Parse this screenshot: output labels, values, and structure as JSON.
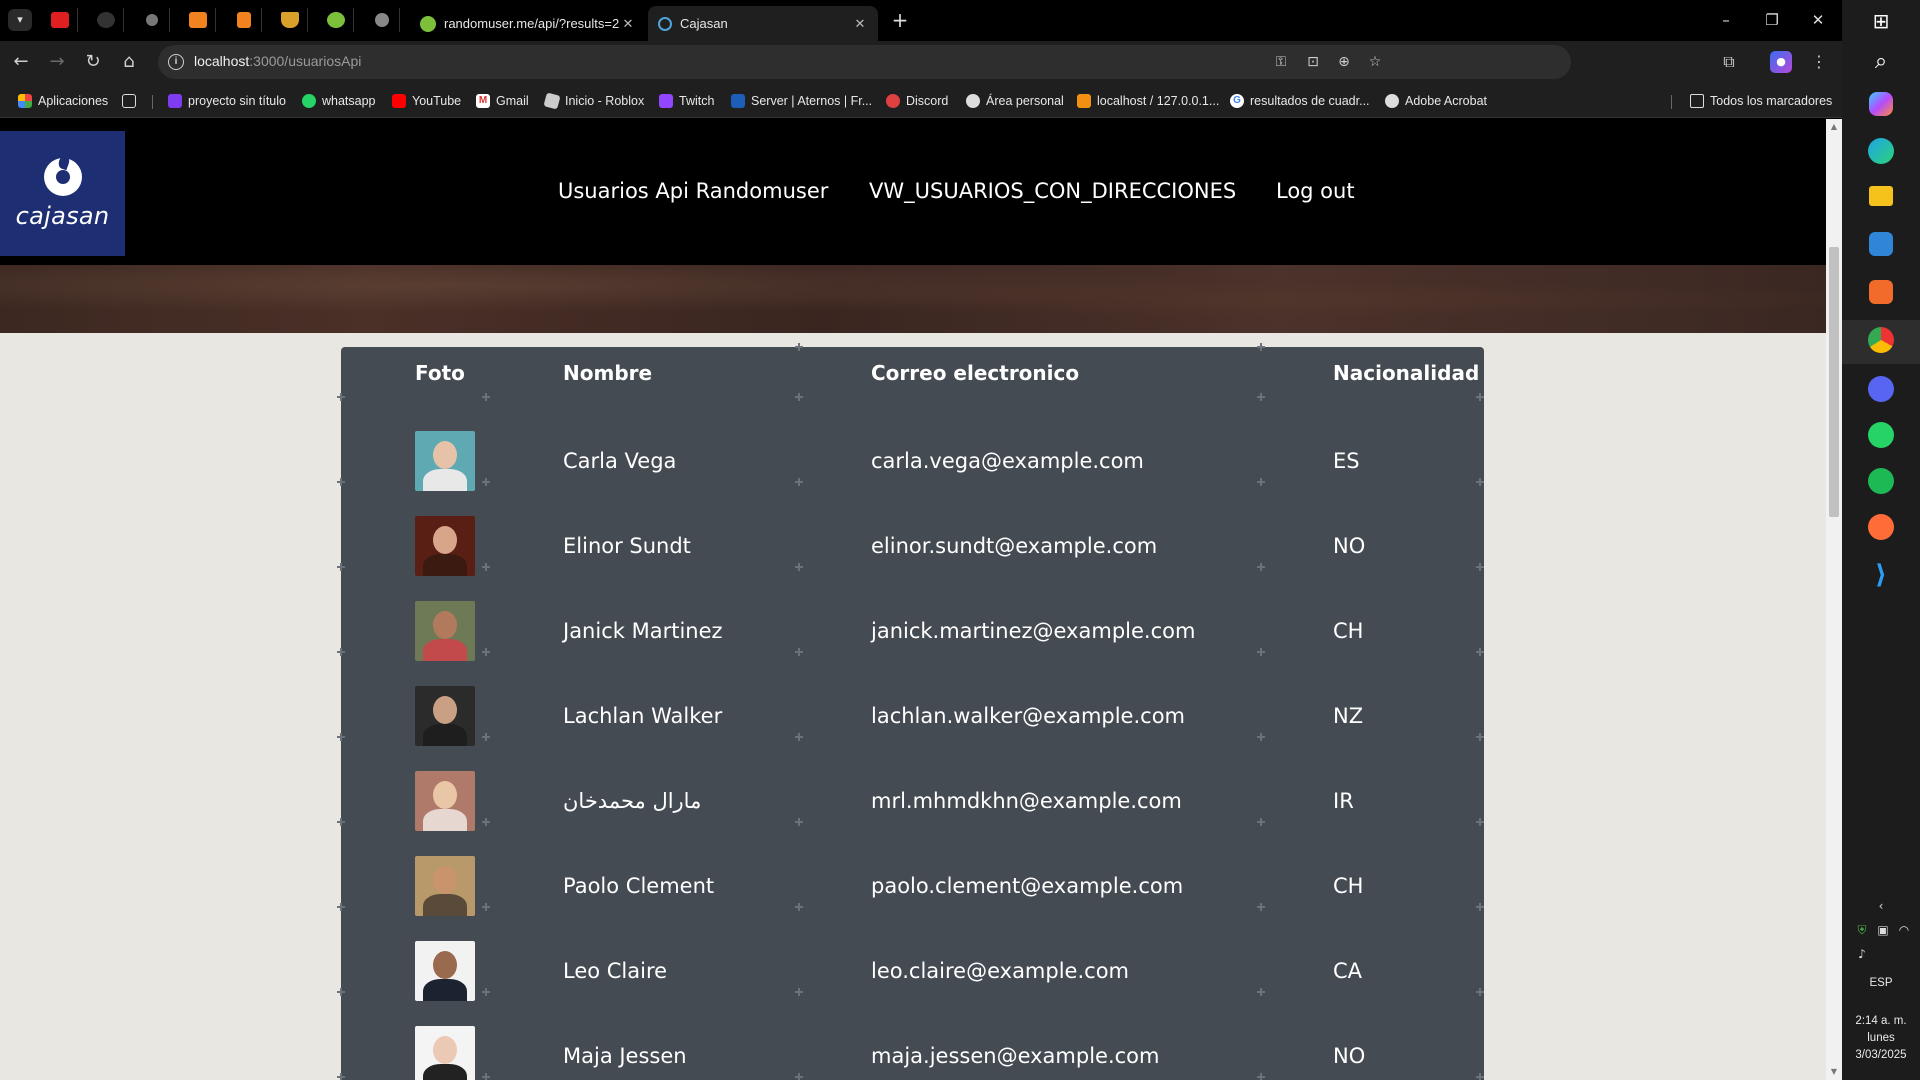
{
  "browser": {
    "tabs": [
      {
        "label": "randomuser.me/api/?results=2",
        "active": false
      },
      {
        "label": "Cajasan",
        "active": true
      }
    ],
    "address": {
      "host": "localhost",
      "path": ":3000/usuariosApi"
    },
    "bookmarks": [
      {
        "label": "Aplicaciones",
        "icon": "apps-grid-icon"
      },
      {
        "label": "proyecto sin título",
        "icon": "canva-icon"
      },
      {
        "label": "whatsapp",
        "icon": "whatsapp-icon"
      },
      {
        "label": "YouTube",
        "icon": "youtube-icon"
      },
      {
        "label": "Gmail",
        "icon": "gmail-icon"
      },
      {
        "label": "Inicio - Roblox",
        "icon": "roblox-icon"
      },
      {
        "label": "Twitch",
        "icon": "twitch-icon"
      },
      {
        "label": "Server | Aternos | Fr...",
        "icon": "aternos-icon"
      },
      {
        "label": "Discord",
        "icon": "discord-icon"
      },
      {
        "label": "Área personal",
        "icon": "moodle-icon"
      },
      {
        "label": "localhost / 127.0.0.1...",
        "icon": "phpmyadmin-icon"
      },
      {
        "label": "resultados de cuadr...",
        "icon": "google-icon"
      },
      {
        "label": "Adobe Acrobat",
        "icon": "globe-icon"
      }
    ],
    "all_bookmarks": "Todos los marcadores"
  },
  "site": {
    "logo_text": "cajasan",
    "nav": [
      "Usuarios Api Randomuser",
      "VW_USUARIOS_CON_DIRECCIONES",
      "Log out"
    ]
  },
  "table": {
    "headers": [
      "Foto",
      "Nombre",
      "Correo electronico",
      "Nacionalidad"
    ],
    "rows": [
      {
        "name": "Carla Vega",
        "email": "carla.vega@example.com",
        "nat": "ES",
        "skin": "#e6c3a8",
        "cloth": "#e8e8e8",
        "bg": "#5fa9b3"
      },
      {
        "name": "Elinor Sundt",
        "email": "elinor.sundt@example.com",
        "nat": "NO",
        "skin": "#d9a58a",
        "cloth": "#3b1a12",
        "bg": "#5a1f14"
      },
      {
        "name": "Janick Martinez",
        "email": "janick.martinez@example.com",
        "nat": "CH",
        "skin": "#b27a5c",
        "cloth": "#c24a4a",
        "bg": "#6e7a55"
      },
      {
        "name": "Lachlan Walker",
        "email": "lachlan.walker@example.com",
        "nat": "NZ",
        "skin": "#caa085",
        "cloth": "#1e1e1e",
        "bg": "#2b2b2b"
      },
      {
        "name": "مارال محمدخان",
        "email": "mrl.mhmdkhn@example.com",
        "nat": "IR",
        "skin": "#e9c6a6",
        "cloth": "#e6d8d0",
        "bg": "#b07a6a"
      },
      {
        "name": "Paolo Clement",
        "email": "paolo.clement@example.com",
        "nat": "CH",
        "skin": "#c9936b",
        "cloth": "#5a4a3a",
        "bg": "#b89a6a"
      },
      {
        "name": "Leo Claire",
        "email": "leo.claire@example.com",
        "nat": "CA",
        "skin": "#9a6a4e",
        "cloth": "#1b2330",
        "bg": "#f2f2f2"
      },
      {
        "name": "Maja Jessen",
        "email": "maja.jessen@example.com",
        "nat": "NO",
        "skin": "#ecc9b5",
        "cloth": "#222222",
        "bg": "#f4f4f4"
      }
    ]
  },
  "taskbar": {
    "lang": "ESP",
    "time": "2:14 a. m.",
    "day": "lunes",
    "date": "3/03/2025"
  }
}
